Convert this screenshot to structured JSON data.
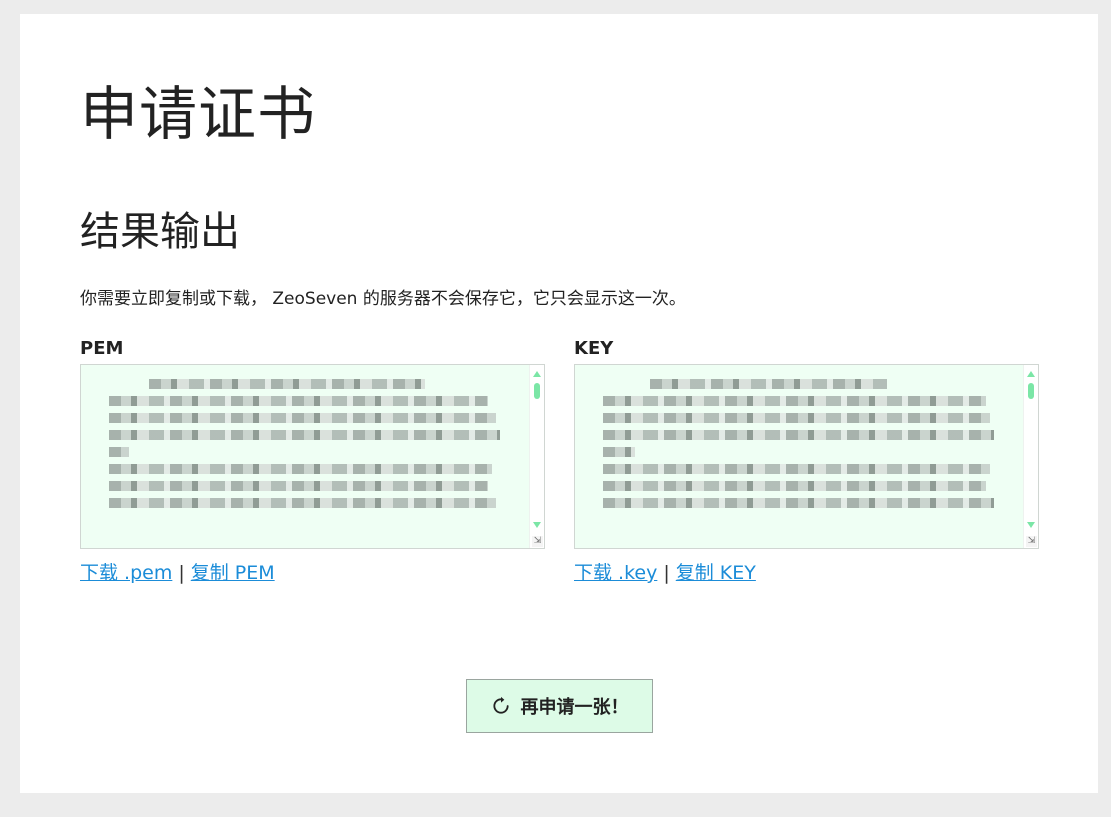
{
  "page": {
    "title": "申请证书",
    "section_title": "结果输出",
    "notice": "你需要立即复制或下载， ZeoSeven 的服务器不会保存它，它只会显示这一次。"
  },
  "pem": {
    "label": "PEM",
    "download_link": "下载 .pem",
    "separator": "|",
    "copy_link": "复制 PEM"
  },
  "key": {
    "label": "KEY",
    "download_link": "下载 .key",
    "separator": "|",
    "copy_link": "复制 KEY"
  },
  "actions": {
    "again_label": "再申请一张！",
    "again_icon": "refresh-icon"
  },
  "colors": {
    "page_background": "#ececec",
    "card_background": "#ffffff",
    "textarea_background": "#effff4",
    "scrollbar_accent": "#7be6a6",
    "link": "#1b8cd8",
    "button_background": "#ddfbe7"
  }
}
